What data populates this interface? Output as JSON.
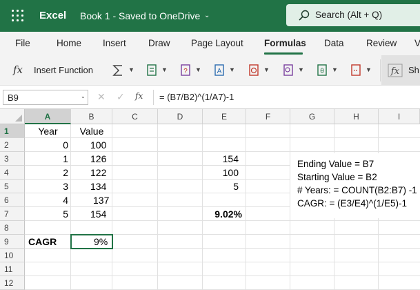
{
  "app": {
    "name": "Excel",
    "doc_title": "Book 1  -  Saved to OneDrive",
    "doc_chevron": "⌄"
  },
  "search": {
    "placeholder": "Search (Alt + Q)"
  },
  "menu": {
    "tabs": [
      "File",
      "Home",
      "Insert",
      "Draw",
      "Page Layout",
      "Formulas",
      "Data",
      "Review",
      "V"
    ],
    "active": "Formulas"
  },
  "ribbon": {
    "fx": "fx",
    "insert_function": "Insert Function",
    "groups": [
      "autosum-icon",
      "recently-used-icon",
      "financial-icon",
      "logical-icon",
      "text-icon",
      "date-time-icon",
      "lookup-icon",
      "more-functions-icon"
    ],
    "last": "Sh"
  },
  "formula_bar": {
    "name_box": "B9",
    "cancel": "✕",
    "enter": "✓",
    "fx": "fx",
    "formula": "= (B7/B2)^(1/A7)-1"
  },
  "grid": {
    "columns": [
      "A",
      "B",
      "C",
      "D",
      "E",
      "F",
      "G",
      "H",
      "I"
    ],
    "selected_column": "A",
    "rows": [
      "1",
      "2",
      "3",
      "4",
      "5",
      "6",
      "7",
      "8",
      "9",
      "10",
      "11",
      "12"
    ],
    "selected_row": "1",
    "selected_cell": "B9",
    "cells": {
      "A1": "Year",
      "B1": "Value",
      "A2": "0",
      "B2": "100",
      "A3": "1",
      "B3": "126",
      "A4": "2",
      "B4": "122",
      "A5": "3",
      "B5": "134",
      "A6": "4",
      "B6": "137",
      "A7": "5",
      "B7": "154",
      "A9": "CAGR",
      "B9": "9%",
      "E3": "154",
      "E4": "100",
      "E5": "5",
      "E7": "9.02%"
    },
    "notes": [
      "Ending Value = B7",
      "Starting Value = B2",
      "# Years: = COUNT(B2:B7) -1",
      "CAGR: = (E3/E4)^(1/E5)-1"
    ]
  },
  "colors": {
    "brand": "#217346",
    "search_bg": "#e1efe7",
    "ribbon_bg": "#f3f3f3"
  }
}
